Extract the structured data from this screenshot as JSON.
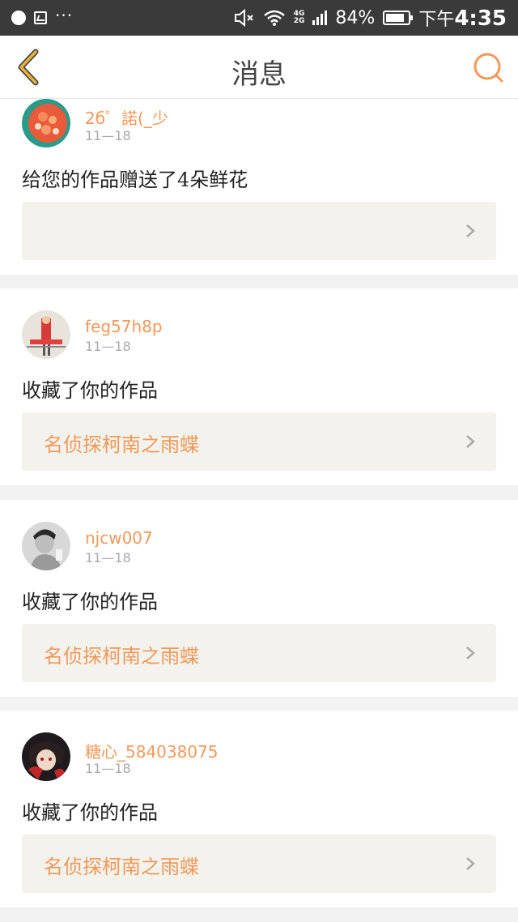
{
  "status_bar": {
    "net_top": "4G",
    "net_bottom": "2G",
    "battery": "84%",
    "battery_level": 0.84,
    "time_prefix": "下午",
    "time": "4:35"
  },
  "header": {
    "title": "消息"
  },
  "messages": [
    {
      "username": "2б゜諾(_少",
      "date": "11—18",
      "action": "给您的作品赠送了4朵鲜花",
      "work_title": ""
    },
    {
      "username": "feg57h8p",
      "date": "11—18",
      "action": "收藏了你的作品",
      "work_title": "名侦探柯南之雨蝶"
    },
    {
      "username": "njcw007",
      "date": "11—18",
      "action": "收藏了你的作品",
      "work_title": "名侦探柯南之雨蝶"
    },
    {
      "username": "糖心_584038075",
      "date": "11—18",
      "action": "收藏了你的作品",
      "work_title": "名侦探柯南之雨蝶"
    }
  ],
  "icons": {
    "back": "back-chevron-icon",
    "search": "search-icon",
    "link": "chevron-right-icon"
  },
  "colors": {
    "accent": "#f2995a",
    "back_arrow": "#e8b13a",
    "status_bar": "#3a3a3a",
    "link_bg": "#f3f2ed"
  }
}
